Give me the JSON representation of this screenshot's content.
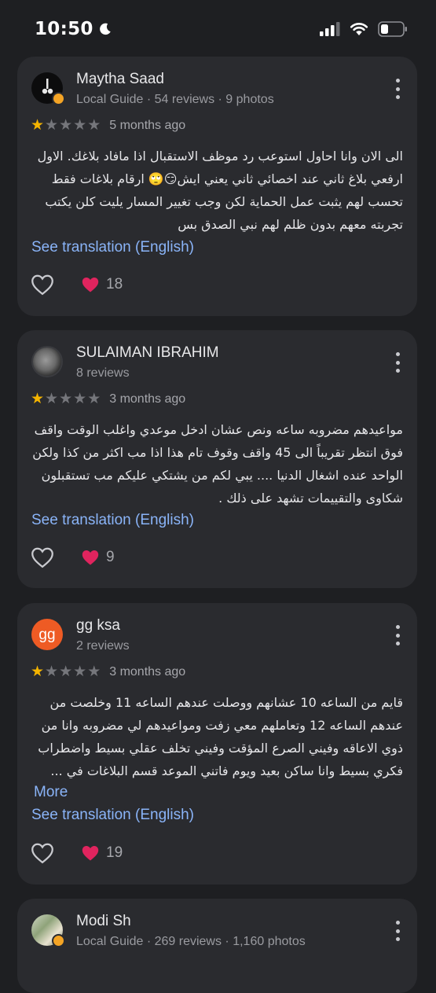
{
  "status_bar": {
    "time": "10:50",
    "icons": [
      "moon-icon",
      "signal-icon",
      "wifi-icon",
      "battery-icon"
    ]
  },
  "colors": {
    "background": "#1e1f22",
    "card": "#2a2b2f",
    "star_filled": "#f4b400",
    "star_empty": "#75767b",
    "link": "#8ab4f8",
    "heart_red": "#e0245e"
  },
  "reviews": [
    {
      "name": "Maytha Saad",
      "meta": "Local Guide · 54 reviews · 9 photos",
      "rating": 1,
      "date": "5 months ago",
      "text": "الى الان وانا احاول استوعب رد موظف الاستقبال اذا مافاد بلاغك. الاول ارفعي بلاغ ثاني عند اخصائي ثاني يعني ايش😏🙄 ارقام بلاغات فقط تحسب لهم يثبت عمل الحماية لكن وجب تغيير المسار يليت كلن يكتب تجربته معهم بدون ظلم لهم نبي الصدق بس",
      "translation_label": "See translation (English)",
      "reactions": "18"
    },
    {
      "name": "SULAIMAN IBRAHIM",
      "meta": "8 reviews",
      "rating": 1,
      "date": "3 months ago",
      "text": "مواعيدهم مضروبه ساعه ونص عشان ادخل موعدي واغلب الوقت واقف فوق انتظر تقريباً الى 45 واقف وقوف تام هذا اذا مب اكثر من كذا ولكن الواحد عنده اشغال الدنيا .... يبي لكم من يشتكي عليكم مب تستقبلون شكاوى والتقييمات تشهد على ذلك .",
      "translation_label": "See translation (English)",
      "reactions": "9"
    },
    {
      "name": "gg ksa",
      "avatar_letters": "gg",
      "meta": "2 reviews",
      "rating": 1,
      "date": "3 months ago",
      "text": "قايم من الساعه 10 عشانهم ووصلت عندهم الساعه 11 وخلصت من عندهم الساعه 12 وتعاملهم معي زفت ومواعيدهم لي مضروبه وانا من ذوي الاعاقه وفيني الصرع المؤقت وفيني تخلف عقلي بسيط واضطراب فكري بسيط وانا ساكن بعيد ويوم فاتني الموعد قسم البلاغات في ...",
      "more_label": "More",
      "translation_label": "See translation (English)",
      "reactions": "19"
    },
    {
      "name": "Modi Sh",
      "meta": "Local Guide · 269 reviews · 1,160 photos"
    }
  ]
}
